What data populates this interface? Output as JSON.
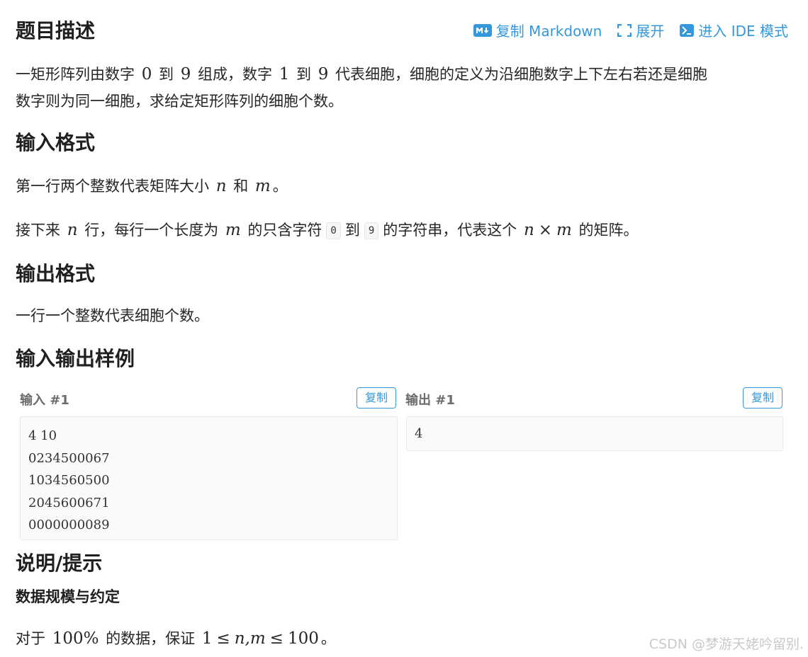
{
  "toolbar": {
    "copy_markdown": "复制 Markdown",
    "expand": "展开",
    "ide_mode": "进入 IDE 模式"
  },
  "description": {
    "title": "题目描述",
    "line1_a": "一矩形阵列由数字 ",
    "line1_0": "0",
    "line1_b": " 到 ",
    "line1_9": "9",
    "line1_c": " 组成，数字 ",
    "line1_1": "1",
    "line1_d": " 到 ",
    "line1_9b": "9",
    "line1_e": " 代表细胞，细胞的定义为沿细胞数字上下左右若还是细胞",
    "line2": "数字则为同一细胞，求给定矩形阵列的细胞个数。"
  },
  "input_format": {
    "title": "输入格式",
    "l1_a": "第一行两个整数代表矩阵大小 ",
    "l1_n": "n",
    "l1_b": " 和 ",
    "l1_m": "m",
    "l1_c": "。",
    "l2_a": "接下来 ",
    "l2_n": "n",
    "l2_b": " 行，每行一个长度为 ",
    "l2_m": "m",
    "l2_c": " 的只含字符",
    "l2_code0": "0",
    "l2_d": "到",
    "l2_code9": "9",
    "l2_e": "的字符串，代表这个 ",
    "l2_n2": "n",
    "l2_times": "×",
    "l2_m2": "m",
    "l2_f": " 的矩阵。"
  },
  "output_format": {
    "title": "输出格式",
    "text": "一行一个整数代表细胞个数。"
  },
  "samples": {
    "title": "输入输出样例",
    "input_label": "输入 #1",
    "output_label": "输出 #1",
    "copy_label": "复制",
    "input_lines": [
      "4 10",
      "0234500067",
      "1034560500",
      "2045600671",
      "0000000089"
    ],
    "output_lines": [
      "4"
    ]
  },
  "hint": {
    "title": "说明/提示",
    "subtitle": "数据规模与约定",
    "text_a": "对于 ",
    "percent": "100%",
    "text_b": " 的数据，保证 ",
    "c1": "1",
    "le1": "≤",
    "vars": "n,m",
    "le2": "≤",
    "c100": "100",
    "text_c": "。"
  },
  "watermark": "CSDN @梦游天姥吟留别."
}
